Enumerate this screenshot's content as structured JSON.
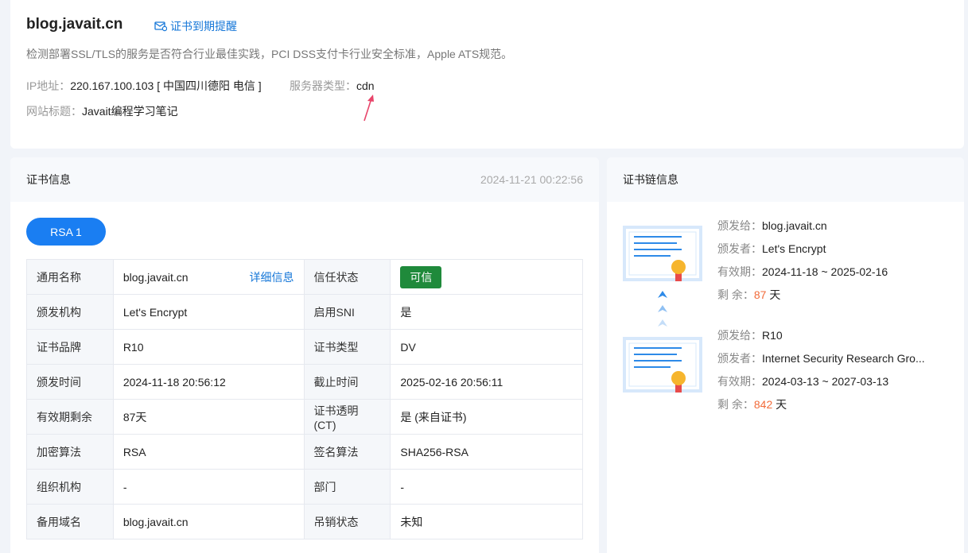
{
  "header": {
    "domain": "blog.javait.cn",
    "remind_label": "证书到期提醒",
    "description": "检测部署SSL/TLS的服务是否符合行业最佳实践，PCI DSS支付卡行业安全标准，Apple ATS规范。",
    "ip_label": "IP地址：",
    "ip_value": "220.167.100.103 [ 中国四川德阳 电信 ]",
    "server_label": "服务器类型：",
    "server_value": "cdn",
    "site_title_label": "网站标题：",
    "site_title_value": "Javait编程学习笔记"
  },
  "cert_info": {
    "title": "证书信息",
    "timestamp": "2024-11-21 00:22:56",
    "tab_label": "RSA 1",
    "detail_link": "详细信息",
    "rows": [
      {
        "k1": "通用名称",
        "v1": "blog.javait.cn",
        "k2": "信任状态",
        "v2": "可信"
      },
      {
        "k1": "颁发机构",
        "v1": "Let's Encrypt",
        "k2": "启用SNI",
        "v2": "是"
      },
      {
        "k1": "证书品牌",
        "v1": "R10",
        "k2": "证书类型",
        "v2": "DV"
      },
      {
        "k1": "颁发时间",
        "v1": "2024-11-18 20:56:12",
        "k2": "截止时间",
        "v2": "2025-02-16 20:56:11"
      },
      {
        "k1": "有效期剩余",
        "v1": "87天",
        "k2": "证书透明(CT)",
        "v2": "是 (来自证书)"
      },
      {
        "k1": "加密算法",
        "v1": "RSA",
        "k2": "签名算法",
        "v2": "SHA256-RSA"
      },
      {
        "k1": "组织机构",
        "v1": "-",
        "k2": "部门",
        "v2": "-"
      },
      {
        "k1": "备用域名",
        "v1": "blog.javait.cn",
        "k2": "吊销状态",
        "v2": "未知"
      }
    ]
  },
  "chain": {
    "title": "证书链信息",
    "issued_to_label": "颁发给：",
    "issuer_label": "颁发者：",
    "validity_label": "有效期：",
    "remaining_label": "剩 余：",
    "days_unit": "天",
    "items": [
      {
        "issued_to": "blog.javait.cn",
        "issuer": "Let's Encrypt",
        "validity": "2024-11-18 ~ 2025-02-16",
        "remaining": "87"
      },
      {
        "issued_to": "R10",
        "issuer": "Internet Security Research Gro...",
        "validity": "2024-03-13 ~ 2027-03-13",
        "remaining": "842"
      }
    ]
  },
  "colors": {
    "accent": "#1a7ef2",
    "link": "#1677d8",
    "trusted": "#1f8a3b",
    "days": "#f26b3a"
  }
}
